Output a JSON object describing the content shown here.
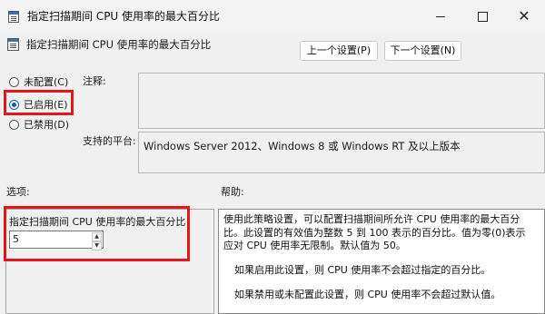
{
  "window": {
    "title": "指定扫描期间 CPU 使用率的最大百分比",
    "icon": "policy-icon"
  },
  "header": {
    "title": "指定扫描期间 CPU 使用率的最大百分比",
    "prev_button": "上一个设置(P)",
    "next_button": "下一个设置(N)"
  },
  "state": {
    "options": [
      {
        "label": "未配置(C)",
        "checked": false
      },
      {
        "label": "已启用(E)",
        "checked": true
      },
      {
        "label": "已禁用(D)",
        "checked": false
      }
    ]
  },
  "comment": {
    "label": "注释:",
    "value": ""
  },
  "platform": {
    "label": "支持的平台:",
    "value": "Windows Server 2012、Windows 8 或 Windows RT 及以上版本"
  },
  "options_panel": {
    "label": "选项:",
    "field_label": "指定扫描期间 CPU 使用率的最大百分比",
    "field_value": "5"
  },
  "help_panel": {
    "label": "帮助:",
    "paragraphs": [
      "使用此策略设置，可以配置扫描期间所允许 CPU 使用率的最大百分比。此设置的有效值为整数 5 到 100 表示的百分比。值为零(0)表示应对 CPU 使用率无限制。默认值为 50。",
      "如果启用此设置，则 CPU 使用率不会超过指定的百分比。",
      "如果禁用或未配置此设置，则 CPU 使用率不会超过默认值。"
    ]
  },
  "colors": {
    "highlight": "#e8141b",
    "radio_accent": "#0a5fb4"
  }
}
